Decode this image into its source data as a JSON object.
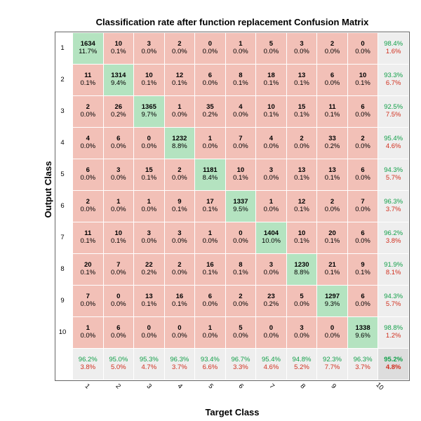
{
  "chart_data": {
    "type": "heatmap",
    "title": "Classification rate after function replacement Confusion Matrix",
    "xlabel": "Target Class",
    "ylabel": "Output Class",
    "classes": [
      "1",
      "2",
      "3",
      "4",
      "5",
      "6",
      "7",
      "8",
      "9",
      "10"
    ],
    "counts": [
      [
        1634,
        10,
        3,
        2,
        0,
        1,
        5,
        3,
        2,
        0
      ],
      [
        11,
        1314,
        10,
        12,
        6,
        8,
        18,
        13,
        6,
        10
      ],
      [
        2,
        26,
        1365,
        1,
        35,
        4,
        10,
        15,
        11,
        6
      ],
      [
        4,
        6,
        0,
        1232,
        1,
        7,
        4,
        2,
        33,
        2
      ],
      [
        6,
        3,
        15,
        2,
        1181,
        10,
        3,
        13,
        13,
        6
      ],
      [
        2,
        1,
        1,
        9,
        17,
        1337,
        1,
        12,
        2,
        7
      ],
      [
        11,
        10,
        3,
        3,
        1,
        0,
        1404,
        10,
        20,
        6
      ],
      [
        20,
        7,
        22,
        2,
        16,
        8,
        3,
        1230,
        21,
        9
      ],
      [
        7,
        0,
        13,
        16,
        6,
        2,
        23,
        5,
        1297,
        6
      ],
      [
        1,
        6,
        0,
        0,
        1,
        5,
        0,
        3,
        0,
        1338
      ]
    ],
    "percent": [
      [
        "11.7%",
        "0.1%",
        "0.0%",
        "0.0%",
        "0.0%",
        "0.0%",
        "0.0%",
        "0.0%",
        "0.0%",
        "0.0%"
      ],
      [
        "0.1%",
        "9.4%",
        "0.1%",
        "0.1%",
        "0.0%",
        "0.1%",
        "0.1%",
        "0.1%",
        "0.0%",
        "0.1%"
      ],
      [
        "0.0%",
        "0.2%",
        "9.7%",
        "0.0%",
        "0.2%",
        "0.0%",
        "0.1%",
        "0.1%",
        "0.1%",
        "0.0%"
      ],
      [
        "0.0%",
        "0.0%",
        "0.0%",
        "8.8%",
        "0.0%",
        "0.0%",
        "0.0%",
        "0.0%",
        "0.2%",
        "0.0%"
      ],
      [
        "0.0%",
        "0.0%",
        "0.1%",
        "0.0%",
        "8.4%",
        "0.1%",
        "0.0%",
        "0.1%",
        "0.1%",
        "0.0%"
      ],
      [
        "0.0%",
        "0.0%",
        "0.0%",
        "0.1%",
        "0.1%",
        "9.5%",
        "0.0%",
        "0.1%",
        "0.0%",
        "0.0%"
      ],
      [
        "0.1%",
        "0.1%",
        "0.0%",
        "0.0%",
        "0.0%",
        "0.0%",
        "10.0%",
        "0.1%",
        "0.1%",
        "0.0%"
      ],
      [
        "0.1%",
        "0.0%",
        "0.2%",
        "0.0%",
        "0.1%",
        "0.1%",
        "0.0%",
        "8.8%",
        "0.1%",
        "0.1%"
      ],
      [
        "0.0%",
        "0.0%",
        "0.1%",
        "0.1%",
        "0.0%",
        "0.0%",
        "0.2%",
        "0.0%",
        "9.3%",
        "0.0%"
      ],
      [
        "0.0%",
        "0.0%",
        "0.0%",
        "0.0%",
        "0.0%",
        "0.0%",
        "0.0%",
        "0.0%",
        "0.0%",
        "9.6%"
      ]
    ],
    "row_acc": [
      "98.4%",
      "93.3%",
      "92.5%",
      "95.4%",
      "94.3%",
      "96.3%",
      "96.2%",
      "91.9%",
      "94.3%",
      "98.8%"
    ],
    "row_err": [
      "1.6%",
      "6.7%",
      "7.5%",
      "4.6%",
      "5.7%",
      "3.7%",
      "3.8%",
      "8.1%",
      "5.7%",
      "1.2%"
    ],
    "col_acc": [
      "96.2%",
      "95.0%",
      "95.3%",
      "96.3%",
      "93.4%",
      "96.7%",
      "95.4%",
      "94.8%",
      "92.3%",
      "96.3%"
    ],
    "col_err": [
      "3.8%",
      "5.0%",
      "4.7%",
      "3.7%",
      "6.6%",
      "3.3%",
      "4.6%",
      "5.2%",
      "7.7%",
      "3.7%"
    ],
    "total_acc": "95.2%",
    "total_err": "4.8%"
  }
}
